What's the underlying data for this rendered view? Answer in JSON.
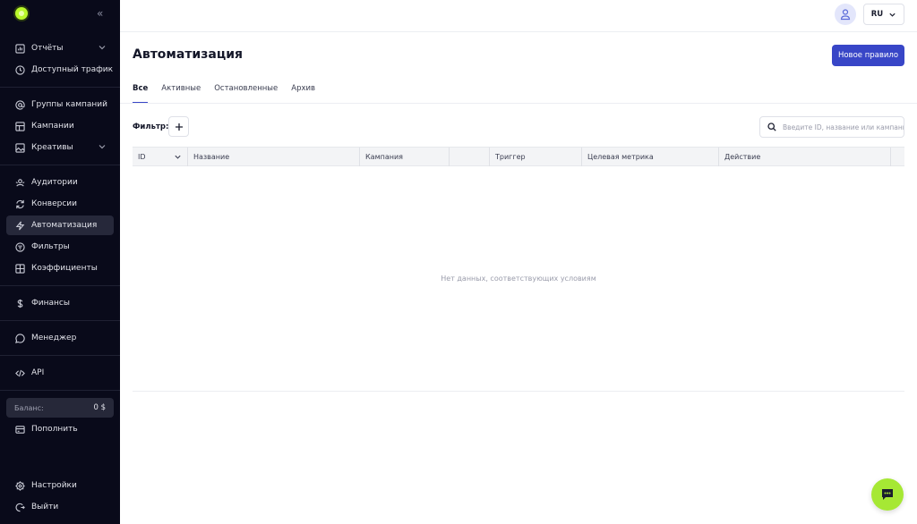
{
  "sidebar": {
    "items": [
      {
        "label": "Отчёты",
        "icon": "chart-icon"
      },
      {
        "label": "Доступный трафик",
        "icon": "clock-icon"
      },
      {
        "label": "Группы кампаний",
        "icon": "at-icon"
      },
      {
        "label": "Кампании",
        "icon": "grid-icon"
      },
      {
        "label": "Креативы",
        "icon": "image-icon"
      },
      {
        "label": "Аудитории",
        "icon": "audience-icon"
      },
      {
        "label": "Конверсии",
        "icon": "refresh-icon"
      },
      {
        "label": "Автоматизация",
        "icon": "lightning-icon"
      },
      {
        "label": "Фильтры",
        "icon": "filter-icon"
      },
      {
        "label": "Коэффициенты",
        "icon": "table-icon"
      },
      {
        "label": "Финансы",
        "icon": "dollar-icon"
      },
      {
        "label": "Менеджер",
        "icon": "chat-icon"
      },
      {
        "label": "API",
        "icon": "code-icon"
      },
      {
        "label": "Пополнить",
        "icon": "wallet-icon"
      },
      {
        "label": "Настройки",
        "icon": "settings-icon"
      },
      {
        "label": "Выйти",
        "icon": "logout-icon"
      }
    ],
    "balance_label": "Баланс:",
    "balance_value": "0 $"
  },
  "header": {
    "language": "RU"
  },
  "main": {
    "title": "Автоматизация",
    "new_rule_label": "Новое правило",
    "tabs": [
      {
        "label": "Все",
        "active": true
      },
      {
        "label": "Активные",
        "active": false
      },
      {
        "label": "Остановленные",
        "active": false
      },
      {
        "label": "Архив",
        "active": false
      }
    ],
    "filter_label": "Фильтр:",
    "search_placeholder": "Введите ID, название или кампанию",
    "columns": [
      {
        "label": "ID"
      },
      {
        "label": "Название"
      },
      {
        "label": "Кампания"
      },
      {
        "label": ""
      },
      {
        "label": "Триггер"
      },
      {
        "label": "Целевая метрика"
      },
      {
        "label": "Действие"
      },
      {
        "label": ""
      }
    ],
    "empty_text": "Нет данных, соответствующих условиям"
  },
  "colors": {
    "sidebar_bg": "#090a1a",
    "accent": "#3846c7",
    "brand_green": "#a6e834"
  }
}
